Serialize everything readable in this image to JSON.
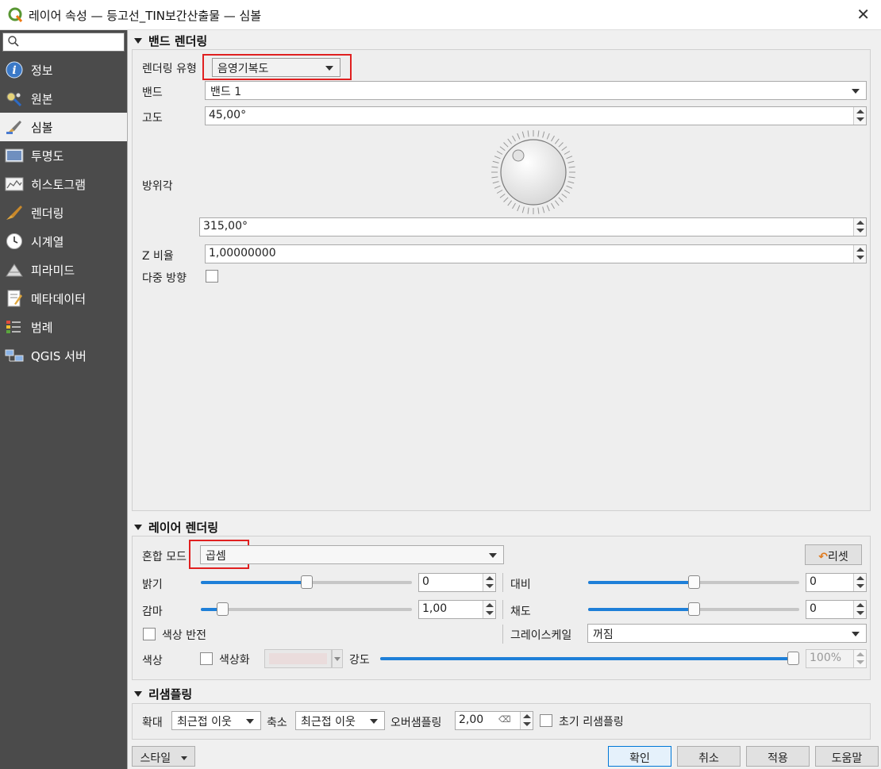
{
  "window": {
    "title": "레이어 속성 — 등고선_TIN보간산출물 — 심볼",
    "close": "✕"
  },
  "sidebar": {
    "search_placeholder": "",
    "items": [
      {
        "label": "정보",
        "icon": "info-icon"
      },
      {
        "label": "원본",
        "icon": "source-icon"
      },
      {
        "label": "심볼",
        "icon": "symbology-icon"
      },
      {
        "label": "투명도",
        "icon": "transparency-icon"
      },
      {
        "label": "히스토그램",
        "icon": "histogram-icon"
      },
      {
        "label": "렌더링",
        "icon": "rendering-icon"
      },
      {
        "label": "시계열",
        "icon": "temporal-icon"
      },
      {
        "label": "피라미드",
        "icon": "pyramids-icon"
      },
      {
        "label": "메타데이터",
        "icon": "metadata-icon"
      },
      {
        "label": "범례",
        "icon": "legend-icon"
      },
      {
        "label": "QGIS 서버",
        "icon": "server-icon"
      }
    ],
    "active_index": 2
  },
  "band_rendering": {
    "header": "밴드 렌더링",
    "render_type_label": "렌더링 유형",
    "render_type_value": "음영기복도",
    "band_label": "밴드",
    "band_value": "밴드 1",
    "altitude_label": "고도",
    "altitude_value": "45,00°",
    "azimuth_label": "방위각",
    "azimuth_value": "315,00°",
    "zfactor_label": "Z 비율",
    "zfactor_value": "1,00000000",
    "multidirectional_label": "다중 방향"
  },
  "layer_rendering": {
    "header": "레이어 렌더링",
    "blend_label": "혼합 모드",
    "blend_value": "곱셈",
    "reset_label": "리셋",
    "brightness_label": "밝기",
    "brightness_value": "0",
    "contrast_label": "대비",
    "contrast_value": "0",
    "gamma_label": "감마",
    "gamma_value": "1,00",
    "saturation_label": "채도",
    "saturation_value": "0",
    "invert_label": "색상 반전",
    "grayscale_label": "그레이스케일",
    "grayscale_value": "꺼짐",
    "hue_label": "색상",
    "colorize_label": "색상화",
    "strength_label": "강도",
    "strength_value": "100%"
  },
  "resampling": {
    "header": "리샘플링",
    "zoomin_label": "확대",
    "zoomin_value": "최근접 이웃",
    "zoomout_label": "축소",
    "zoomout_value": "최근접 이웃",
    "oversampling_label": "오버샘플링",
    "oversampling_value": "2,00",
    "early_label": "초기 리샘플링"
  },
  "footer": {
    "style": "스타일",
    "ok": "확인",
    "cancel": "취소",
    "apply": "적용",
    "help": "도움말"
  },
  "colors": {
    "accent": "#1e7fd8",
    "highlight": "#e02020",
    "sidebar": "#4b4b4b"
  }
}
